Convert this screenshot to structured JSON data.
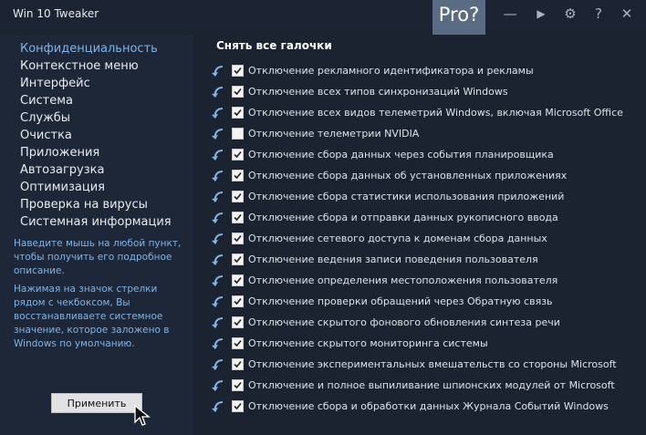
{
  "app": {
    "title": "Win 10 Tweaker",
    "pro_label": "Pro?"
  },
  "window_controls": [
    {
      "name": "minimize-icon",
      "glyph": "—"
    },
    {
      "name": "play-icon",
      "glyph": "▶"
    },
    {
      "name": "gear-icon",
      "glyph": "⚙"
    },
    {
      "name": "help-icon",
      "glyph": "?"
    },
    {
      "name": "close-icon",
      "glyph": "✕"
    }
  ],
  "sidebar": {
    "items": [
      {
        "label": "Конфиденциальность",
        "active": true
      },
      {
        "label": "Контекстное меню",
        "active": false
      },
      {
        "label": "Интерфейс",
        "active": false
      },
      {
        "label": "Система",
        "active": false
      },
      {
        "label": "Службы",
        "active": false
      },
      {
        "label": "Очистка",
        "active": false
      },
      {
        "label": "Приложения",
        "active": false
      },
      {
        "label": "Автозагрузка",
        "active": false
      },
      {
        "label": "Оптимизация",
        "active": false
      },
      {
        "label": "Проверка на вирусы",
        "active": false
      },
      {
        "label": "Системная информация",
        "active": false
      }
    ],
    "help_1": "Наведите мышь на любой пункт, чтобы получить его подробное описание.",
    "help_2": "Нажимая на значок стрелки рядом с чекбоксом, Вы восстанавливаете системное значение, которое заложено в Windows по умолчанию.",
    "apply_label": "Применить"
  },
  "main": {
    "uncheck_all_label": "Снять все галочки",
    "options": [
      {
        "label": "Отключение рекламного идентификатора и рекламы",
        "checked": true
      },
      {
        "label": "Отключение всех типов синхронизаций Windows",
        "checked": true
      },
      {
        "label": "Отключение всех видов телеметрий Windows, включая Microsoft Office",
        "checked": true
      },
      {
        "label": "Отключение телеметрии NVIDIA",
        "checked": false
      },
      {
        "label": "Отключение сбора данных через события планировщика",
        "checked": true
      },
      {
        "label": "Отключение сбора данных об установленных приложениях",
        "checked": true
      },
      {
        "label": "Отключение сбора статистики использования приложений",
        "checked": true
      },
      {
        "label": "Отключение сбора и отправки данных рукописного ввода",
        "checked": true
      },
      {
        "label": "Отключение сетевого доступа к доменам сбора данных",
        "checked": true
      },
      {
        "label": "Отключение ведения записи поведения пользователя",
        "checked": true
      },
      {
        "label": "Отключение определения местоположения пользователя",
        "checked": true
      },
      {
        "label": "Отключение проверки обращений через Обратную связь",
        "checked": true
      },
      {
        "label": "Отключение скрытого фонового обновления синтеза речи",
        "checked": true
      },
      {
        "label": "Отключение скрытого мониторинга системы",
        "checked": true
      },
      {
        "label": "Отключение экспериментальных вмешательств со стороны Microsoft",
        "checked": true
      },
      {
        "label": "Отключение и полное выпиливание шпионских модулей от Microsoft",
        "checked": true
      },
      {
        "label": "Отключение сбора и обработки данных Журнала Событий Windows",
        "checked": true
      }
    ]
  },
  "colors": {
    "accent": "#7fb4e8",
    "background": "#1b2331",
    "sidebar": "#1e2738",
    "pro_badge": "#5a6b84"
  }
}
